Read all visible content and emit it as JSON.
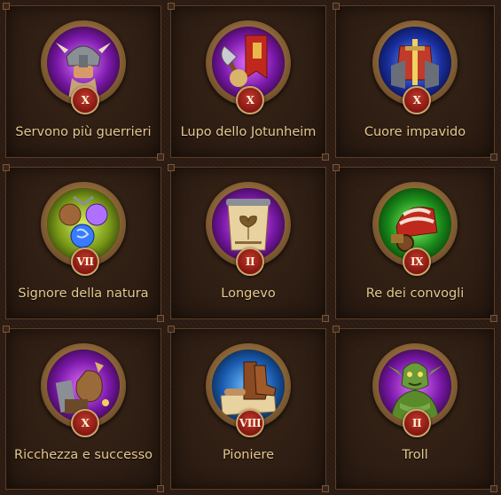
{
  "perks": [
    {
      "name": "Servono più guerrieri",
      "level": "X",
      "icon": "warrior-helmet-icon",
      "glow": "#b040e0"
    },
    {
      "name": "Lupo dello Jotunheim",
      "level": "X",
      "icon": "axe-banner-icon",
      "glow": "#a030c0"
    },
    {
      "name": "Cuore impavido",
      "level": "X",
      "icon": "armor-sword-icon",
      "glow": "#2040c0"
    },
    {
      "name": "Signore della natura",
      "level": "VII",
      "icon": "nature-orbs-icon",
      "glow": "#8ab020"
    },
    {
      "name": "Longevo",
      "level": "II",
      "icon": "ancient-scroll-icon",
      "glow": "#a030c0"
    },
    {
      "name": "Re dei convogli",
      "level": "IX",
      "icon": "wagon-icon",
      "glow": "#30a030"
    },
    {
      "name": "Ricchezza e successo",
      "level": "X",
      "icon": "treasure-sack-icon",
      "glow": "#a030c0"
    },
    {
      "name": "Pioniere",
      "level": "VIII",
      "icon": "boots-map-icon",
      "glow": "#2070c0"
    },
    {
      "name": "Troll",
      "level": "II",
      "icon": "troll-icon",
      "glow": "#a030c0"
    }
  ]
}
